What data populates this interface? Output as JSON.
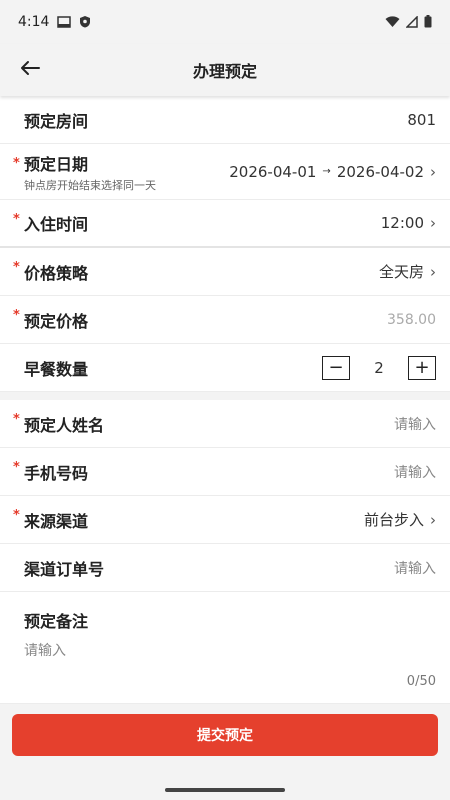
{
  "status_bar": {
    "time": "4:14"
  },
  "app_bar": {
    "title": "办理预定"
  },
  "form": {
    "room": {
      "label": "预定房间",
      "value": "801"
    },
    "dates": {
      "label": "预定日期",
      "hint": "钟点房开始结束选择同一天",
      "start": "2026-04-01",
      "arrow": "→",
      "end": "2026-04-02"
    },
    "checkin_time": {
      "label": "入住时间",
      "value": "12:00"
    },
    "price_policy": {
      "label": "价格策略",
      "value": "全天房"
    },
    "price": {
      "label": "预定价格",
      "value": "358.00"
    },
    "breakfast": {
      "label": "早餐数量",
      "value": "2",
      "minus": "−",
      "plus": "+"
    },
    "guest_name": {
      "label": "预定人姓名",
      "placeholder": "请输入"
    },
    "phone": {
      "label": "手机号码",
      "placeholder": "请输入"
    },
    "source": {
      "label": "来源渠道",
      "value": "前台步入"
    },
    "channel_order": {
      "label": "渠道订单号",
      "placeholder": "请输入"
    },
    "remarks": {
      "label": "预定备注",
      "placeholder": "请输入",
      "counter": "0/50"
    }
  },
  "submit": {
    "label": "提交预定"
  },
  "colors": {
    "accent": "#e5402d",
    "required": "#e53a2a"
  },
  "icons": [
    "back-arrow-icon",
    "gallery-icon",
    "shield-icon",
    "wifi-icon",
    "signal-icon",
    "battery-icon",
    "chevron-right-icon"
  ]
}
